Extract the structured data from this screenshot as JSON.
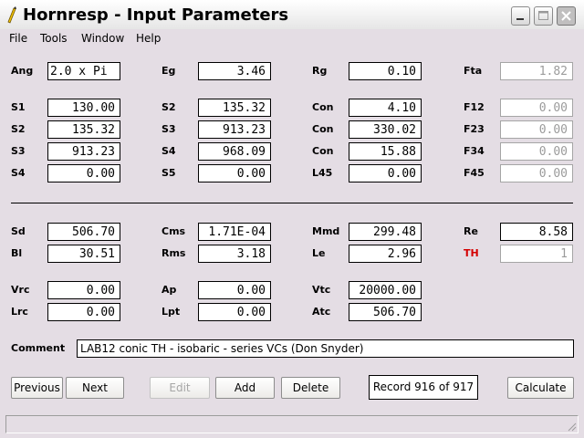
{
  "window": {
    "title": "Hornresp - Input Parameters"
  },
  "menu": [
    "File",
    "Tools",
    "Window",
    "Help"
  ],
  "params": {
    "Ang": {
      "label": "Ang",
      "value": "2.0 x Pi"
    },
    "Eg": {
      "label": "Eg",
      "value": "3.46"
    },
    "Rg": {
      "label": "Rg",
      "value": "0.10"
    },
    "Fta": {
      "label": "Fta",
      "value": "1.82"
    },
    "S1": {
      "label": "S1",
      "value": "130.00"
    },
    "S2a": {
      "label": "S2",
      "value": "135.32"
    },
    "Con1": {
      "label": "Con",
      "value": "4.10"
    },
    "F12": {
      "label": "F12",
      "value": "0.00"
    },
    "S2b": {
      "label": "S2",
      "value": "135.32"
    },
    "S3a": {
      "label": "S3",
      "value": "913.23"
    },
    "Con2": {
      "label": "Con",
      "value": "330.02"
    },
    "F23": {
      "label": "F23",
      "value": "0.00"
    },
    "S3b": {
      "label": "S3",
      "value": "913.23"
    },
    "S4a": {
      "label": "S4",
      "value": "968.09"
    },
    "Con3": {
      "label": "Con",
      "value": "15.88"
    },
    "F34": {
      "label": "F34",
      "value": "0.00"
    },
    "S4b": {
      "label": "S4",
      "value": "0.00"
    },
    "S5": {
      "label": "S5",
      "value": "0.00"
    },
    "L45": {
      "label": "L45",
      "value": "0.00"
    },
    "F45": {
      "label": "F45",
      "value": "0.00"
    },
    "Sd": {
      "label": "Sd",
      "value": "506.70"
    },
    "Cms": {
      "label": "Cms",
      "value": "1.71E-04"
    },
    "Mmd": {
      "label": "Mmd",
      "value": "299.48"
    },
    "Re": {
      "label": "Re",
      "value": "8.58"
    },
    "Bl": {
      "label": "Bl",
      "value": "30.51"
    },
    "Rms": {
      "label": "Rms",
      "value": "3.18"
    },
    "Le": {
      "label": "Le",
      "value": "2.96"
    },
    "TH": {
      "label": "TH",
      "value": "1"
    },
    "Vrc": {
      "label": "Vrc",
      "value": "0.00"
    },
    "Ap": {
      "label": "Ap",
      "value": "0.00"
    },
    "Vtc": {
      "label": "Vtc",
      "value": "20000.00"
    },
    "Lrc": {
      "label": "Lrc",
      "value": "0.00"
    },
    "Lpt": {
      "label": "Lpt",
      "value": "0.00"
    },
    "Atc": {
      "label": "Atc",
      "value": "506.70"
    }
  },
  "comment": {
    "label": "Comment",
    "value": "LAB12 conic TH - isobaric - series VCs (Don Snyder)"
  },
  "buttons": {
    "previous": "Previous",
    "next": "Next",
    "edit": "Edit",
    "add": "Add",
    "delete": "Delete",
    "calculate": "Calculate"
  },
  "record": "Record 916 of 917",
  "colors": {
    "background": "#e4dde4",
    "th_label": "#d40000",
    "disabled_text": "#9b9b9b"
  }
}
